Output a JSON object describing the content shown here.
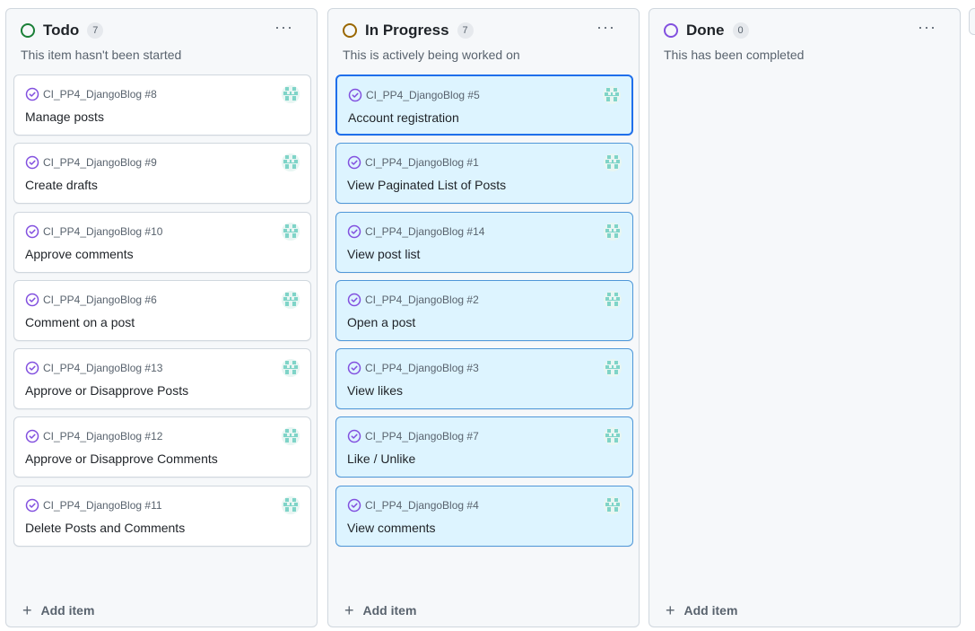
{
  "columns": [
    {
      "title": "Todo",
      "count": "7",
      "status_color": "#1a7f37",
      "description": "This item hasn't been started",
      "menu_icon": "kebab-horizontal-icon",
      "add_label": "Add item",
      "cards": [
        {
          "repo": "CI_PP4_DjangoBlog #8",
          "title": "Manage posts"
        },
        {
          "repo": "CI_PP4_DjangoBlog #9",
          "title": "Create drafts"
        },
        {
          "repo": "CI_PP4_DjangoBlog #10",
          "title": "Approve comments"
        },
        {
          "repo": "CI_PP4_DjangoBlog #6",
          "title": "Comment on a post"
        },
        {
          "repo": "CI_PP4_DjangoBlog #13",
          "title": "Approve or Disapprove Posts"
        },
        {
          "repo": "CI_PP4_DjangoBlog #12",
          "title": "Approve or Disapprove Comments"
        },
        {
          "repo": "CI_PP4_DjangoBlog #11",
          "title": "Delete Posts and Comments"
        }
      ]
    },
    {
      "title": "In Progress",
      "count": "7",
      "status_color": "#9a6700",
      "description": "This is actively being worked on",
      "menu_icon": "kebab-horizontal-icon",
      "add_label": "Add item",
      "cards": [
        {
          "repo": "CI_PP4_DjangoBlog #5",
          "title": "Account registration"
        },
        {
          "repo": "CI_PP4_DjangoBlog #1",
          "title": "View Paginated List of Posts"
        },
        {
          "repo": "CI_PP4_DjangoBlog #14",
          "title": "View post list"
        },
        {
          "repo": "CI_PP4_DjangoBlog #2",
          "title": "Open a post"
        },
        {
          "repo": "CI_PP4_DjangoBlog #3",
          "title": "View likes"
        },
        {
          "repo": "CI_PP4_DjangoBlog #7",
          "title": "Like / Unlike"
        },
        {
          "repo": "CI_PP4_DjangoBlog #4",
          "title": "View comments"
        }
      ]
    },
    {
      "title": "Done",
      "count": "0",
      "status_color": "#8250df",
      "description": "This has been completed",
      "menu_icon": "kebab-horizontal-icon",
      "add_label": "Add item",
      "cards": []
    }
  ],
  "icons": {
    "issue": "issue-closed-icon",
    "avatar": "identicon-avatar",
    "add": "plus-icon"
  },
  "colors": {
    "issue_icon": "#8250df",
    "active_card_bg": "#ddf4ff",
    "avatar": "#7fd4c8"
  }
}
